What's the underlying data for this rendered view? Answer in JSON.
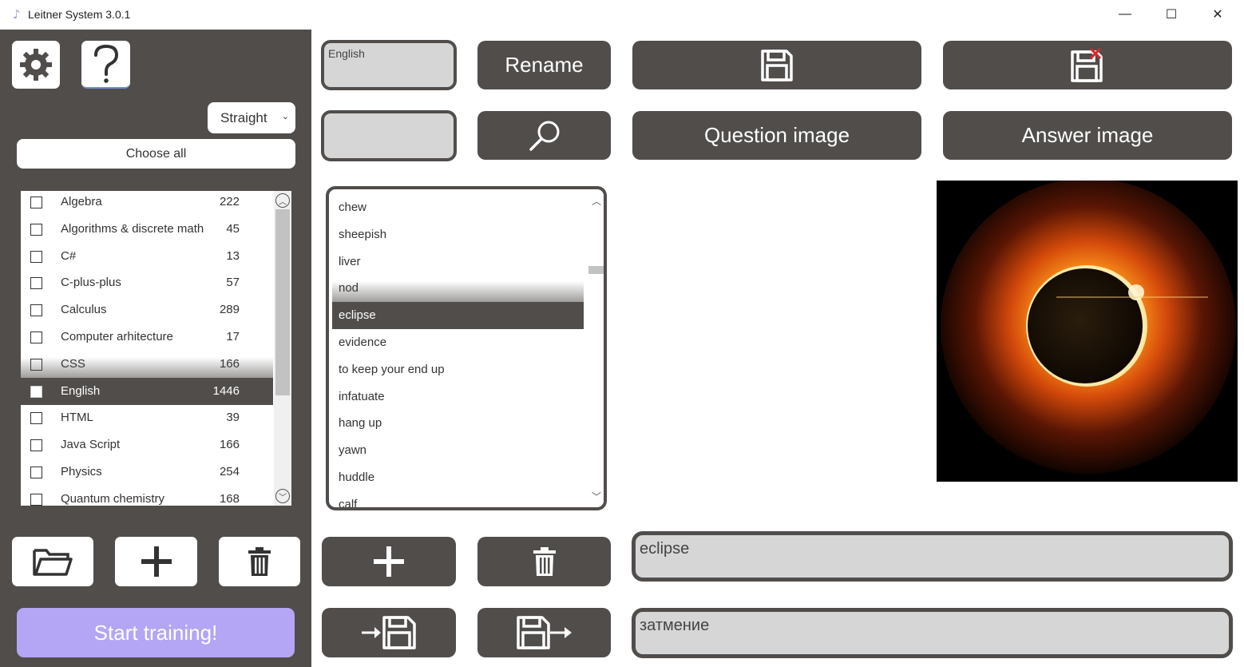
{
  "window": {
    "title": "Leitner System 3.0.1",
    "minimize_glyph": "—",
    "maximize_glyph": "☐",
    "close_glyph": "✕"
  },
  "left": {
    "mode_select": "Straight",
    "choose_all": "Choose all",
    "categories": [
      {
        "name": "Algebra",
        "count": "222"
      },
      {
        "name": "Algorithms & discrete math",
        "count": "45"
      },
      {
        "name": "C#",
        "count": "13"
      },
      {
        "name": "C-plus-plus",
        "count": "57"
      },
      {
        "name": "Calculus",
        "count": "289"
      },
      {
        "name": "Computer arhitecture",
        "count": "17"
      },
      {
        "name": "CSS",
        "count": "166"
      },
      {
        "name": "English",
        "count": "1446"
      },
      {
        "name": "HTML",
        "count": "39"
      },
      {
        "name": "Java Script",
        "count": "166"
      },
      {
        "name": "Physics",
        "count": "254"
      },
      {
        "name": "Quantum chemistry",
        "count": "168"
      }
    ],
    "selected_category_index": 7,
    "start_training": "Start training!"
  },
  "main": {
    "deck_name_value": "English",
    "search_value": "",
    "rename_label": "Rename",
    "question_image_label": "Question image",
    "answer_image_label": "Answer image",
    "words": [
      "chew",
      "sheepish",
      "liver",
      "nod",
      "eclipse",
      "evidence",
      "to keep your end up",
      "infatuate",
      "hang up",
      "yawn",
      "huddle",
      "calf"
    ],
    "selected_word_index": 4,
    "question_value": "eclipse",
    "answer_value": "затмение"
  },
  "colors": {
    "panel": "#504d4b",
    "accent": "#b4a6f4",
    "field": "#d6d6d6",
    "delete_mark": "#d9262c"
  }
}
